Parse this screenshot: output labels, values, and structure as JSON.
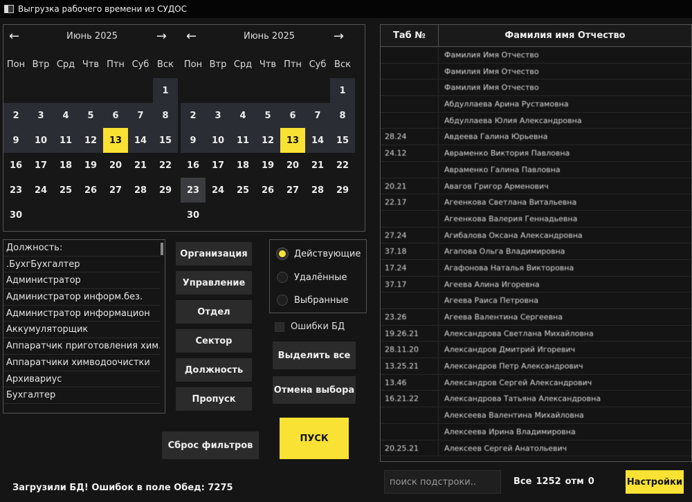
{
  "window": {
    "title": "Выгрузка рабочего времени из СУДОС"
  },
  "calendars": [
    {
      "month_label": "Июнь  2025",
      "prev_icon": "arrow-left-icon",
      "next_icon": "arrow-right-icon",
      "today": 13
    },
    {
      "month_label": "Июнь  2025",
      "prev_icon": "arrow-left-icon",
      "next_icon": "arrow-right-icon",
      "today": 13
    }
  ],
  "weekdays": [
    "Пон",
    "Втр",
    "Срд",
    "Чтв",
    "Птн",
    "Суб",
    "Вск"
  ],
  "weeks": [
    [
      "",
      "",
      "",
      "",
      "",
      "",
      "1"
    ],
    [
      "2",
      "3",
      "4",
      "5",
      "6",
      "7",
      "8"
    ],
    [
      "9",
      "10",
      "11",
      "12",
      "13",
      "14",
      "15"
    ],
    [
      "16",
      "17",
      "18",
      "19",
      "20",
      "21",
      "22"
    ],
    [
      "23",
      "24",
      "25",
      "26",
      "27",
      "28",
      "29"
    ],
    [
      "30",
      "",
      "",
      "",
      "",
      "",
      ""
    ]
  ],
  "positions": {
    "items": [
      "Должность:",
      ".БухгБухгалтер",
      "Администратор",
      "Администратор информ.без.",
      "Администратор информацион",
      "Аккумуляторщик",
      "Аппаратчик приготовления хим. ра",
      "Аппаратчики химводоочистки",
      "Архивариус",
      "Бухгалтер"
    ]
  },
  "filter_buttons": [
    "Организация",
    "Управление",
    "Отдел",
    "Сектор",
    "Должность",
    "Пропуск"
  ],
  "reset_label": "Сброс фильтров",
  "radio": {
    "options": [
      "Действующие",
      "Удалённые",
      "Выбранные"
    ],
    "selected": "Действующие"
  },
  "errors_checkbox_label": "Ошибки БД",
  "select_all_label": "Выделить все",
  "deselect_label": "Отмена выбора",
  "start_label": "ПУСК",
  "status_text": "Загрузили БД! Ошибок в поле Обед: 7275",
  "employees": {
    "columns": [
      "Таб №",
      "Фамилия имя Отчество"
    ],
    "rows": [
      [
        "",
        "Фамилия Имя Отчество"
      ],
      [
        "",
        "Фамилия Имя Отчество"
      ],
      [
        "",
        "Фамилия Имя Отчество"
      ],
      [
        "",
        "Абдуллаева Арина Рустамовна"
      ],
      [
        "",
        "Абдуллаева Юлия Александровна"
      ],
      [
        "28.24",
        "Авдеева Галина Юрьевна"
      ],
      [
        "24.12",
        "Авраменко Виктория Павловна"
      ],
      [
        "",
        "Авраменко Галина Павловна"
      ],
      [
        "20.21",
        "Авагов Григор Арменович"
      ],
      [
        "22.17",
        "Агеенкова Светлана Витальевна"
      ],
      [
        "",
        "Агеенкова Валерия Геннадьевна"
      ],
      [
        "27.24",
        "Агибалова Оксана Александровна"
      ],
      [
        "37.18",
        "Агапова Ольга Владимировна"
      ],
      [
        "17.24",
        "Агафонова Наталья Викторовна"
      ],
      [
        "37.17",
        "Агеева Алина Игоревна"
      ],
      [
        "",
        "Агеева Раиса Петровна"
      ],
      [
        "23.26",
        "Агеева Валентина Сергеевна"
      ],
      [
        "19.26.21",
        "Александрова Светлана Михайловна"
      ],
      [
        "28.11.20",
        "Александров Дмитрий Игоревич"
      ],
      [
        "13.25.21",
        "Александров Петр Александрович"
      ],
      [
        "13.46",
        "Александров Сергей Александрович"
      ],
      [
        "16.21.22",
        "Александрова Татьяна Александровна"
      ],
      [
        "",
        "Алексеева Валентина Михайловна"
      ],
      [
        "",
        "Алексеева Ирина Владимировна"
      ],
      [
        "20.25.21",
        "Алексеев Сергей Анатольевич"
      ]
    ]
  },
  "search": {
    "placeholder": "поиск подстроки..",
    "value": ""
  },
  "counts": {
    "all_label": "Все",
    "all_value": "1252",
    "sel_label": "отм",
    "sel_value": "0"
  },
  "settings_label": "Настройки",
  "colors": {
    "accent": "#f9e234",
    "background": "#151515",
    "button": "#2b2b2b",
    "range": "#2a2d33"
  }
}
